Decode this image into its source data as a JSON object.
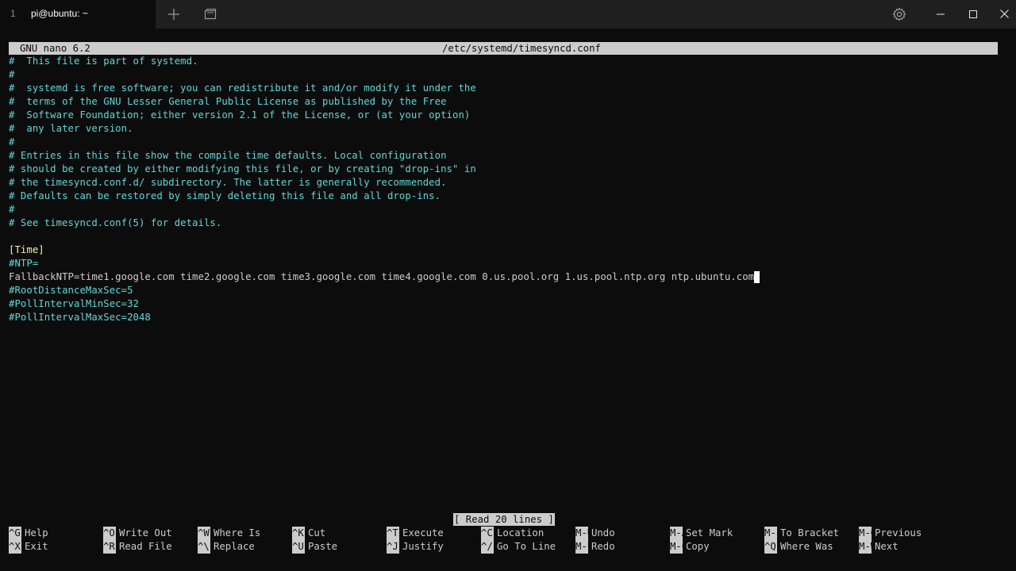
{
  "window": {
    "tab_index": "1",
    "tab_title": "pi@ubuntu: ~"
  },
  "icons": {
    "new_tab": "plus-icon",
    "dropdown": "window-dropdown-icon",
    "settings": "gear-icon",
    "minimize": "minimize-icon",
    "maximize": "maximize-icon",
    "close": "close-icon"
  },
  "nano": {
    "version": "GNU nano 6.2",
    "filename": "/etc/systemd/timesyncd.conf",
    "status": "[ Read 20 lines ]"
  },
  "file_lines": [
    "#  This file is part of systemd.",
    "#",
    "#  systemd is free software; you can redistribute it and/or modify it under the",
    "#  terms of the GNU Lesser General Public License as published by the Free",
    "#  Software Foundation; either version 2.1 of the License, or (at your option)",
    "#  any later version.",
    "#",
    "# Entries in this file show the compile time defaults. Local configuration",
    "# should be created by either modifying this file, or by creating \"drop-ins\" in",
    "# the timesyncd.conf.d/ subdirectory. The latter is generally recommended.",
    "# Defaults can be restored by simply deleting this file and all drop-ins.",
    "#",
    "# See timesyncd.conf(5) for details.",
    "",
    "[Time]",
    "#NTP=",
    "FallbackNTP=time1.google.com time2.google.com time3.google.com time4.google.com 0.us.pool.org 1.us.pool.ntp.org ntp.ubuntu.com",
    "#RootDistanceMaxSec=5",
    "#PollIntervalMinSec=32",
    "#PollIntervalMaxSec=2048"
  ],
  "shortcuts": [
    {
      "key": "^G",
      "label": "Help"
    },
    {
      "key": "^X",
      "label": "Exit"
    },
    {
      "key": "^O",
      "label": "Write Out"
    },
    {
      "key": "^R",
      "label": "Read File"
    },
    {
      "key": "^W",
      "label": "Where Is"
    },
    {
      "key": "^\\",
      "label": "Replace"
    },
    {
      "key": "^K",
      "label": "Cut"
    },
    {
      "key": "^U",
      "label": "Paste"
    },
    {
      "key": "^T",
      "label": "Execute"
    },
    {
      "key": "^J",
      "label": "Justify"
    },
    {
      "key": "^C",
      "label": "Location"
    },
    {
      "key": "^/",
      "label": "Go To Line"
    },
    {
      "key": "M-U",
      "label": "Undo"
    },
    {
      "key": "M-E",
      "label": "Redo"
    },
    {
      "key": "M-A",
      "label": "Set Mark"
    },
    {
      "key": "M-6",
      "label": "Copy"
    },
    {
      "key": "M-]",
      "label": "To Bracket"
    },
    {
      "key": "^Q",
      "label": "Where Was"
    },
    {
      "key": "M-Q",
      "label": "Previous"
    },
    {
      "key": "M-W",
      "label": "Next"
    }
  ],
  "colors": {
    "background": "#0c0c0c",
    "comment": "#61d6d6",
    "section": "#f9f1a5",
    "text": "#cccccc",
    "inverse_bg": "#cccccc"
  }
}
